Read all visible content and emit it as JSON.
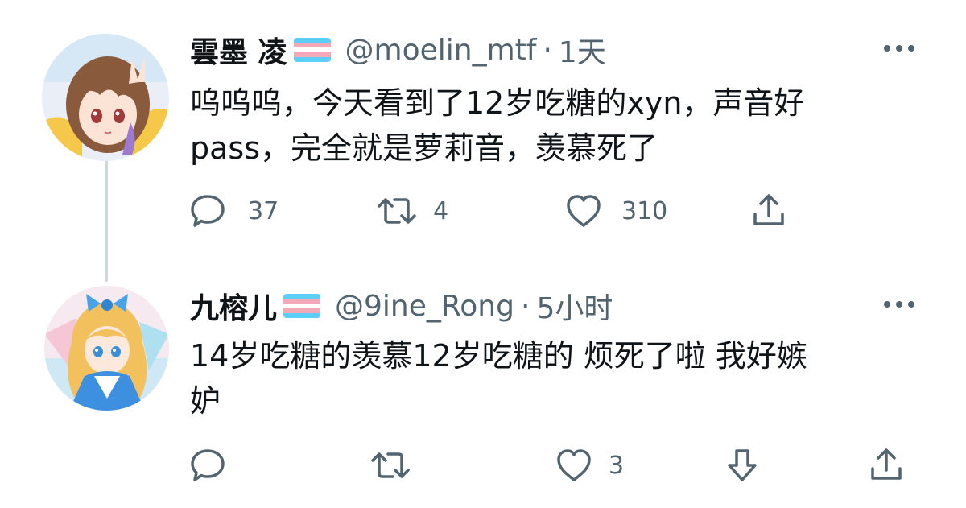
{
  "tweets": [
    {
      "name": "雲墨 凌",
      "handle": "@moelin_mtf",
      "separator": "·",
      "time": "1天",
      "text_line1": "呜呜呜，今天看到了12岁吃糖的xyn，声音好",
      "text_line2": "pass，完全就是萝莉音，羡慕死了",
      "reply_count": "37",
      "retweet_count": "4",
      "like_count": "310"
    },
    {
      "name": "九榕儿",
      "handle": "@9ine_Rong",
      "separator": "·",
      "time": "5小时",
      "text_line1": "14岁吃糖的羡慕12岁吃糖的 烦死了啦 我好嫉",
      "text_line2": "妒",
      "like_count": "3"
    }
  ],
  "icons": {
    "more": "more-horizontal-icon",
    "reply": "reply-bubble-icon",
    "retweet": "retweet-icon",
    "like": "heart-icon",
    "share": "share-icon",
    "downvote": "arrow-down-icon",
    "flag": "transgender-flag-icon"
  },
  "colors": {
    "text": "#0f1419",
    "secondary": "#536471",
    "thread_line": "#cfd9de",
    "flag_blue": "#5bcefa",
    "flag_pink": "#f5a9b8",
    "flag_white": "#ffffff"
  }
}
